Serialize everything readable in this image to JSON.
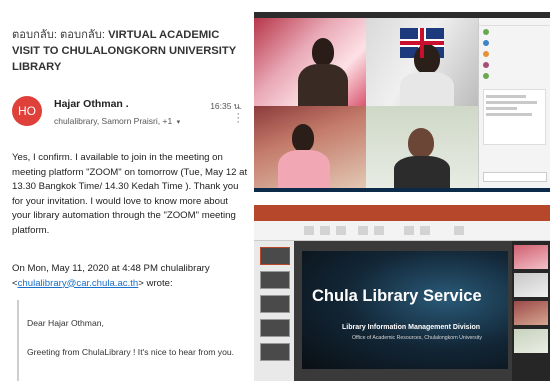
{
  "email": {
    "subject_prefix": "ตอบกลับ: ตอบกลับ:",
    "subject": "VIRTUAL ACADEMIC VISIT TO CHULALONGKORN UNIVERSITY LIBRARY",
    "avatar_initials": "HO",
    "sender": "Hajar Othman .",
    "recipients": "chulalibrary, Samorn  Praisri, +1",
    "time": "16:35 น.",
    "body": "Yes, I confirm. I available to join in the meeting on meeting platform \"ZOOM\" on tomorrow (Tue, May 12 at 13.30 Bangkok Time/ 14.30 Kedah Time ). Thank you for your invitation. I would love to know more about your library automation through the \"ZOOM\" meeting platform.",
    "quote_intro": "On Mon, May 11, 2020 at 4:48 PM chulalibrary",
    "quote_email": "chulalibrary@car.chula.ac.th",
    "quote_wrote": "> wrote:",
    "quote_lt": "<",
    "quote_greeting": "Dear Hajar Othman,",
    "quote_line": "Greeting from ChulaLibrary ! It's nice to hear from you."
  },
  "slide": {
    "title": "Chula Library Service",
    "subtitle": "Library Information Management Division",
    "subtitle2": "Office of Academic Resources, Chulalongkorn University"
  },
  "colors": {
    "avatar": "#e0403a",
    "link": "#1a6fc9",
    "powerpoint_bar": "#b7472a"
  }
}
